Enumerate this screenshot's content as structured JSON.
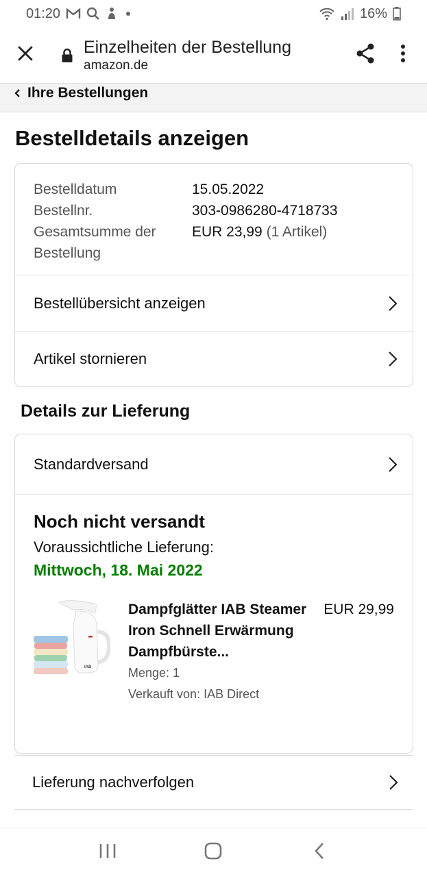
{
  "status_bar": {
    "time": "01:20",
    "battery": "16%",
    "icons": [
      "gmail-icon",
      "search-icon",
      "notification-icon",
      "dot-icon",
      "wifi-icon",
      "signal-icon",
      "battery-icon"
    ]
  },
  "toolbar": {
    "title": "Einzelheiten der Bestellung",
    "url": "amazon.de",
    "icons": [
      "close-icon",
      "lock-icon",
      "share-icon",
      "more-vert-icon"
    ]
  },
  "breadcrumb": {
    "label": "Ihre Bestellungen"
  },
  "page_title": "Bestelldetails anzeigen",
  "order_summary": {
    "rows": [
      {
        "key": "Bestelldatum",
        "value": "15.05.2022"
      },
      {
        "key": "Bestellnr.",
        "value": "303-0986280-4718733"
      },
      {
        "key": "Gesamtsumme der Bestellung",
        "value": "EUR 23,99",
        "value_suffix": "(1 Artikel)"
      }
    ],
    "links": [
      {
        "label": "Bestellübersicht anzeigen"
      },
      {
        "label": "Artikel stornieren"
      }
    ]
  },
  "delivery": {
    "section_title": "Details zur Lieferung",
    "shipping_method": "Standardversand",
    "status": "Noch nicht versandt",
    "expected_label": "Voraussichtliche Lieferung:",
    "expected_date": "Mittwoch, 18. Mai 2022",
    "item": {
      "title": "Dampfglätter IAB Steamer Iron Schnell Erwärmung Dampfbürste...",
      "quantity": "Menge: 1",
      "seller": "Verkauft von: IAB Direct",
      "price": "EUR 29,99",
      "image_brand": "IAB"
    },
    "track_label": "Lieferung nachverfolgen"
  },
  "colors": {
    "accent_green": "#067d00",
    "border": "#d5d9d9",
    "breadcrumb_bg": "#f3f3f3"
  },
  "navbar": {
    "icons": [
      "recent-apps-icon",
      "home-icon",
      "back-icon"
    ]
  }
}
